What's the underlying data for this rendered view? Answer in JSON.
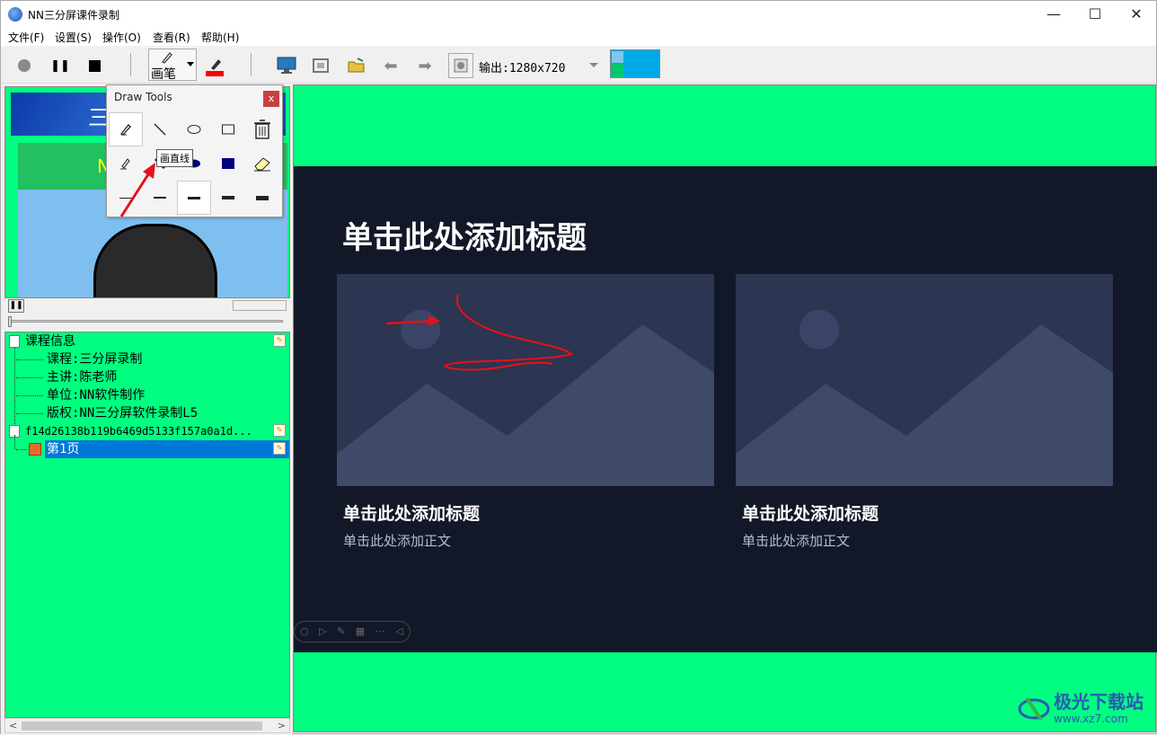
{
  "window": {
    "title": "NN三分屏课件录制",
    "minimize": "—",
    "maximize": "☐",
    "close": "✕"
  },
  "menu": {
    "items": [
      "文件(F)",
      "设置(S)",
      "操作(O)",
      "查看(R)",
      "帮助(H)"
    ]
  },
  "toolbar": {
    "pen_label": "画笔",
    "output_label": "输出:1280x720",
    "colors": {
      "record": "#8a8a8a",
      "stop": "#000000",
      "pen_color": "#ff0000"
    }
  },
  "camera": {
    "banner_text": "三",
    "green_text": "N"
  },
  "draw_tools": {
    "title": "Draw Tools",
    "close": "x",
    "tooltip": "画直线"
  },
  "tree": {
    "course_info": "课程信息",
    "children": [
      "课程:三分屏录制",
      "主讲:陈老师",
      "单位:NN软件制作",
      "版权:NN三分屏软件录制L5"
    ],
    "file_node": "f14d26138b119b6469d5133f157a0a1d...",
    "page_node": "第1页"
  },
  "slide": {
    "title": "单击此处添加标题",
    "cards": [
      {
        "title": "单击此处添加标题",
        "text": "单击此处添加正文"
      },
      {
        "title": "单击此处添加标题",
        "text": "单击此处添加正文"
      }
    ],
    "bg_color": "#121828"
  },
  "watermark": {
    "name": "极光下载站",
    "url": "www.xz7.com"
  }
}
